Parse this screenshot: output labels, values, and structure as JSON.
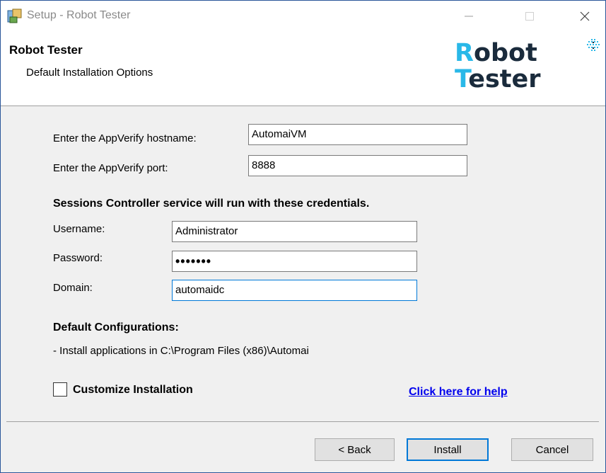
{
  "window": {
    "title": "Setup - Robot Tester"
  },
  "header": {
    "title": "Robot Tester",
    "subtitle": "Default Installation Options",
    "logo_line1_first": "R",
    "logo_line1_rest": "obot",
    "logo_line2_first": "T",
    "logo_line2_rest": "ester"
  },
  "appverify": {
    "hostname_label": "Enter the AppVerify hostname:",
    "hostname_value": "AutomaiVM",
    "port_label": "Enter the AppVerify port:",
    "port_value": "8888"
  },
  "credentials": {
    "heading": "Sessions Controller service will run with these credentials.",
    "username_label": "Username:",
    "username_value": "Administrator",
    "password_label": "Password:",
    "password_value": "•••••••",
    "domain_label": "Domain:",
    "domain_value": "automaidc"
  },
  "defaults": {
    "heading": "Default Configurations:",
    "install_path_text": "- Install applications in C:\\Program Files (x86)\\Automai"
  },
  "options": {
    "customize_label": "Customize Installation",
    "customize_checked": false,
    "help_link": "Click here for help"
  },
  "buttons": {
    "back": "< Back",
    "install": "Install",
    "cancel": "Cancel"
  },
  "colors": {
    "accent": "#0078d7",
    "logo_accent": "#29b8e8",
    "link": "#0000ee"
  }
}
